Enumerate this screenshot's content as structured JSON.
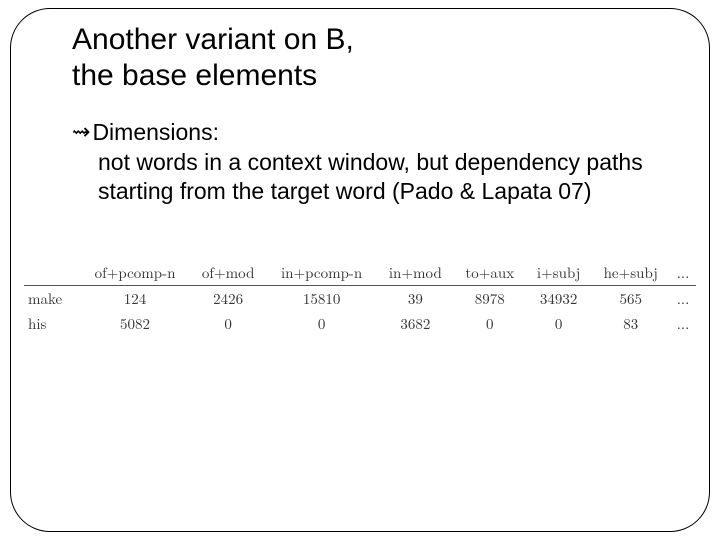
{
  "title_line1": "Another variant on B,",
  "title_line2": "the base elements",
  "bullet": {
    "head": "Dimensions:",
    "body": "not words in a context window, but dependency paths starting from the target word (Pado & Lapata 07)"
  },
  "chart_data": {
    "type": "table",
    "columns": [
      "of+pcomp-n",
      "of+mod",
      "in+pcomp-n",
      "in+mod",
      "to+aux",
      "i+subj",
      "he+subj"
    ],
    "ellipsis": "...",
    "rows": [
      {
        "label": "make",
        "values": [
          124,
          2426,
          15810,
          39,
          8978,
          34932,
          565
        ]
      },
      {
        "label": "his",
        "values": [
          5082,
          0,
          0,
          3682,
          0,
          0,
          83
        ]
      }
    ]
  }
}
